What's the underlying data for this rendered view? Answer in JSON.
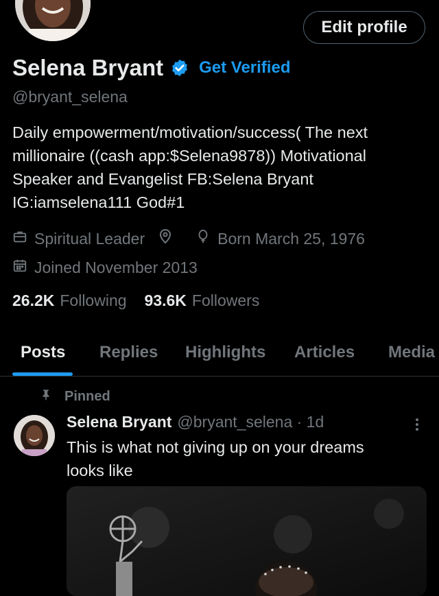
{
  "profile": {
    "edit_profile": "Edit profile",
    "name": "Selena Bryant",
    "get_verified": "Get Verified",
    "handle": "@bryant_selena",
    "bio_lines": [
      "Daily empowerment/motivation/success( The next",
      "millionaire ((cash app:$Selena9878)) Motivational",
      "Speaker and Evangelist FB:Selena Bryant",
      "IG:iamselena111 God#1"
    ],
    "occupation": "Spiritual Leader",
    "born": "Born March 25, 1976",
    "joined": "Joined November 2013",
    "following_count": "26.2K",
    "following_label": "Following",
    "followers_count": "93.6K",
    "followers_label": "Followers"
  },
  "tabs": [
    "Posts",
    "Replies",
    "Highlights",
    "Articles",
    "Media"
  ],
  "post": {
    "pinned_label": "Pinned",
    "author": "Selena Bryant",
    "handle_time": "@bryant_selena · 1d",
    "text_lines": [
      "This is what not giving up on your dreams",
      "looks like"
    ]
  },
  "colors": {
    "accent": "#1d9bf0",
    "background": "#000000",
    "text_primary": "#e7e9ea",
    "text_secondary": "#71767b"
  },
  "icons": [
    "verified-badge-icon",
    "briefcase-icon",
    "location-icon",
    "balloon-icon",
    "calendar-icon",
    "pin-icon",
    "more-vertical-icon"
  ]
}
